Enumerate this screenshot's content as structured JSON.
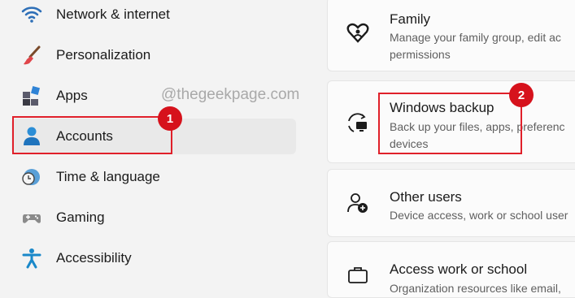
{
  "watermark": "@thegeekpage.com",
  "sidebar": {
    "items": [
      {
        "label": "Network & internet",
        "icon": "wifi-icon"
      },
      {
        "label": "Personalization",
        "icon": "paintbrush-icon"
      },
      {
        "label": "Apps",
        "icon": "apps-icon"
      },
      {
        "label": "Accounts",
        "icon": "person-icon",
        "selected": true
      },
      {
        "label": "Time & language",
        "icon": "globe-clock-icon"
      },
      {
        "label": "Gaming",
        "icon": "gamepad-icon"
      },
      {
        "label": "Accessibility",
        "icon": "accessibility-icon"
      }
    ]
  },
  "annotations": {
    "badge1": "1",
    "badge2": "2",
    "highlight_color": "#e0202a",
    "badge_color": "#d6121c"
  },
  "main": {
    "cards": [
      {
        "title": "Family",
        "desc_line1": "Manage your family group, edit ac",
        "desc_line2": "permissions",
        "icon": "family-heart-icon"
      },
      {
        "title": "Windows backup",
        "desc_line1": "Back up your files, apps, preferenc",
        "desc_line2": "devices",
        "icon": "backup-sync-icon"
      },
      {
        "title": "Other users",
        "desc_line1": "Device access, work or school user",
        "icon": "add-user-icon"
      },
      {
        "title": "Access work or school",
        "desc_line1": "Organization resources like email,",
        "icon": "briefcase-icon"
      }
    ]
  },
  "colors": {
    "accent": "#0f6cbd",
    "selected_bg": "#e9e9e9"
  }
}
